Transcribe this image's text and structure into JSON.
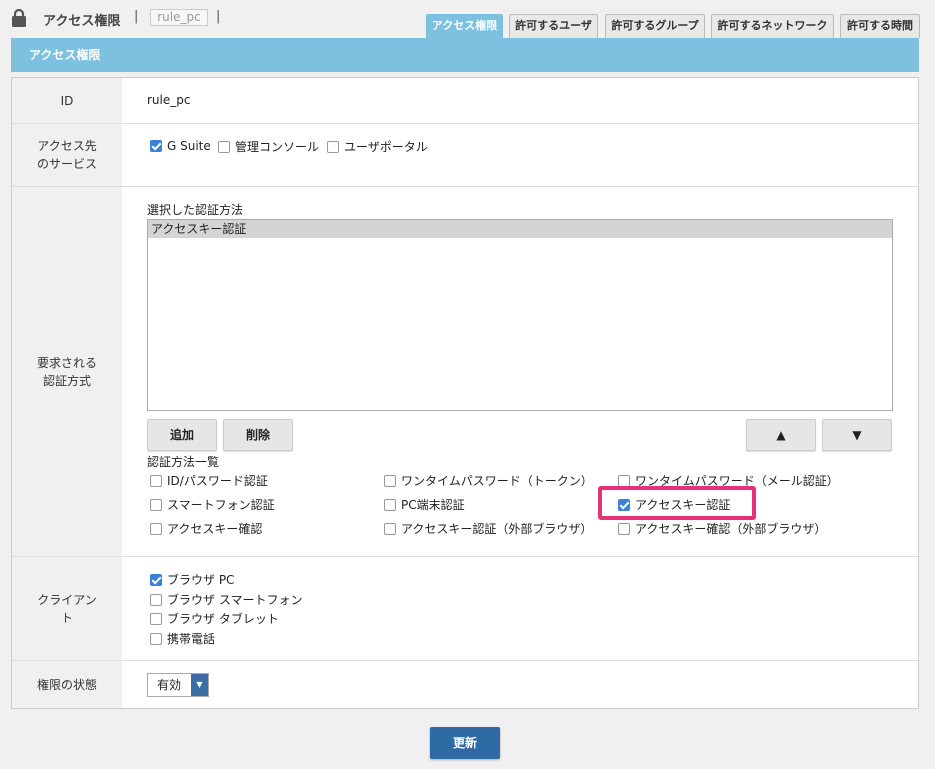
{
  "header": {
    "title": "アクセス権限",
    "separator": "|",
    "rule_name": "rule_pc"
  },
  "tabs": [
    {
      "label": "アクセス権限",
      "active": true
    },
    {
      "label": "許可するユーザ",
      "active": false
    },
    {
      "label": "許可するグループ",
      "active": false
    },
    {
      "label": "許可するネットワーク",
      "active": false
    },
    {
      "label": "許可する時間",
      "active": false
    }
  ],
  "banner": {
    "title": "アクセス権限"
  },
  "form": {
    "id": {
      "label": "ID",
      "value": "rule_pc"
    },
    "services": {
      "label_line1": "アクセス先",
      "label_line2": "のサービス",
      "options": [
        {
          "label": "G Suite",
          "checked": true
        },
        {
          "label": "管理コンソール",
          "checked": false
        },
        {
          "label": "ユーザポータル",
          "checked": false
        }
      ]
    },
    "auth": {
      "label_line1": "要求される",
      "label_line2": "認証方式",
      "selected_title": "選択した認証方法",
      "selected_items": [
        "アクセスキー認証"
      ],
      "add_label": "追加",
      "delete_label": "削除",
      "up_label": "▲",
      "down_label": "▼",
      "list_title": "認証方法一覧",
      "methods": [
        {
          "label": "ID/パスワード認証",
          "checked": false
        },
        {
          "label": "ワンタイムパスワード（トークン）",
          "checked": false
        },
        {
          "label": "ワンタイムパスワード（メール認証）",
          "checked": false
        },
        {
          "label": "スマートフォン認証",
          "checked": false
        },
        {
          "label": "PC端末認証",
          "checked": false
        },
        {
          "label": "アクセスキー認証",
          "checked": true
        },
        {
          "label": "アクセスキー確認",
          "checked": false
        },
        {
          "label": "アクセスキー認証（外部ブラウザ）",
          "checked": false
        },
        {
          "label": "アクセスキー確認（外部ブラウザ）",
          "checked": false
        }
      ]
    },
    "client": {
      "label_line1": "クライアン",
      "label_line2": "ト",
      "options": [
        {
          "label": "ブラウザ PC",
          "checked": true
        },
        {
          "label": "ブラウザ スマートフォン",
          "checked": false
        },
        {
          "label": "ブラウザ タブレット",
          "checked": false
        },
        {
          "label": "携帯電話",
          "checked": false
        }
      ]
    },
    "status": {
      "label": "権限の状態",
      "value": "有効"
    }
  },
  "submit_label": "更新",
  "colors": {
    "accent": "#7ec0df",
    "primary_button": "#2e6aa3",
    "highlight": "#e8307a",
    "checkbox": "#3a82d9"
  }
}
